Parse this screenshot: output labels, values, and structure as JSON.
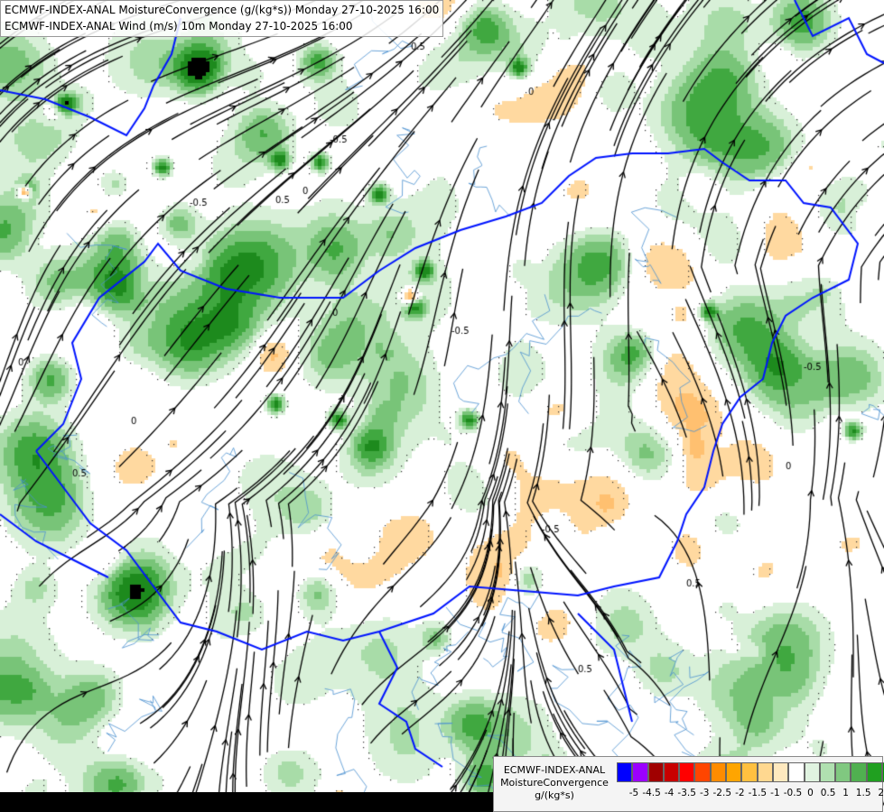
{
  "title": {
    "line1": "ECMWF-INDEX-ANAL MoistureConvergence (g/(kg*s)) Monday 27-10-2025 16:00",
    "line2": "ECMWF-INDEX-ANAL Wind (m/s) 10m Monday 27-10-2025 16:00"
  },
  "legend": {
    "line1": "ECMWF-INDEX-ANAL",
    "line2": "MoistureConvergence",
    "line3": "g/(kg*s)",
    "colors": [
      "#0000ff",
      "#9b00ff",
      "#a00000",
      "#c80000",
      "#ff0000",
      "#ff4500",
      "#ff8c00",
      "#ffa500",
      "#ffc040",
      "#ffd890",
      "#ffe9bf",
      "#ffffff",
      "#e0f3e0",
      "#b0e0b0",
      "#80c880",
      "#50b050",
      "#20a020",
      "#00a000"
    ],
    "labels": [
      "-5",
      "-4.5",
      "-4",
      "-3.5",
      "-3",
      "-2.5",
      "-2",
      "-1.5",
      "-1",
      "-0.5",
      "0",
      "0.5",
      "1",
      "1.5",
      "2"
    ]
  },
  "contour_labels": [
    "0",
    "-0.5",
    "0.5"
  ]
}
